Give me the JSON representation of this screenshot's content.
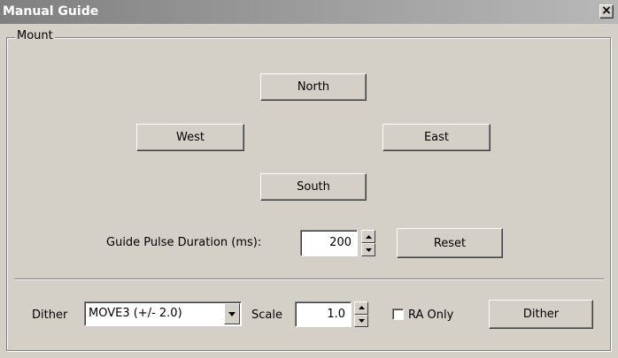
{
  "window": {
    "title": "Manual Guide",
    "close_glyph": "×",
    "background": "#d4d0c8",
    "titlebar_colors": [
      "#808080",
      "#b8b8b8"
    ]
  },
  "mount": {
    "group_label": "Mount",
    "north_label": "North",
    "west_label": "West",
    "east_label": "East",
    "south_label": "South",
    "pulse_label": "Guide Pulse Duration (ms):",
    "pulse_value": "200",
    "reset_label": "Reset"
  },
  "dither": {
    "label": "Dither",
    "mode_value": "MOVE3 (+/- 2.0)",
    "scale_label": "Scale",
    "scale_value": "1.0",
    "ra_only_label": "RA Only",
    "ra_only_checked": false,
    "button_label": "Dither"
  }
}
